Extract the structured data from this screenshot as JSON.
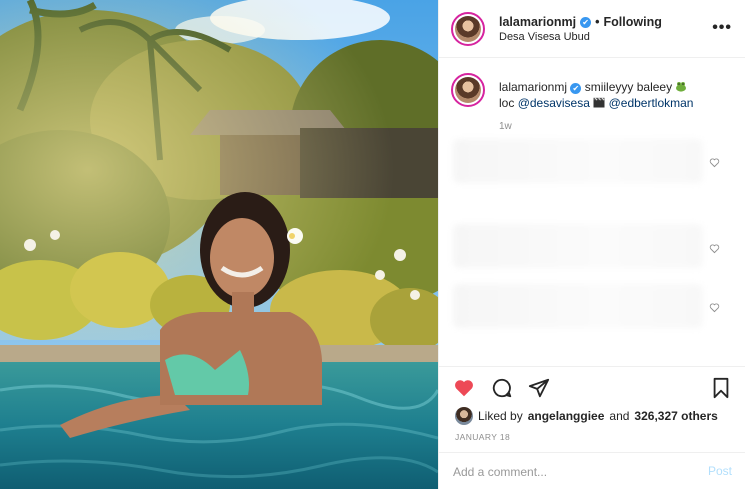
{
  "header": {
    "username": "lalamarionmj",
    "verified_mark": "✔",
    "separator": "•",
    "follow_label": "Following",
    "location": "Desa Visesa Ubud",
    "more_label": "•••"
  },
  "caption": {
    "username": "lalamarionmj",
    "text": "smiileyyy baleey",
    "loc_prefix": "loc",
    "mention_1": "@desavisesa",
    "mention_2": "@edbertlokman",
    "age": "1w"
  },
  "likes": {
    "prefix": "Liked by",
    "user": "angelanggiee",
    "connector": "and",
    "count": "326,327 others"
  },
  "date": "JANUARY 18",
  "comment_box": {
    "placeholder": "Add a comment...",
    "post_label": "Post"
  },
  "icons": [
    "heart-filled-icon",
    "comment-icon",
    "share-icon",
    "bookmark-icon",
    "more-icon",
    "verified-icon",
    "small-heart-icon",
    "emoji-icon",
    "clapper-icon"
  ],
  "colors": {
    "like_red": "#ed4956",
    "verified_blue": "#3897f0",
    "post_disabled": "#b2dffc",
    "mention": "#003569"
  }
}
